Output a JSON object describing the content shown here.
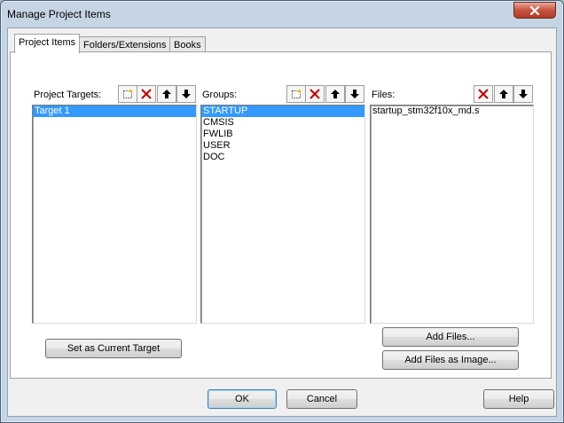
{
  "window": {
    "title": "Manage Project Items"
  },
  "tabs": [
    {
      "label": "Project Items",
      "active": true
    },
    {
      "label": "Folders/Extensions",
      "active": false
    },
    {
      "label": "Books",
      "active": false
    }
  ],
  "targets": {
    "label": "Project Targets:",
    "items": [
      "Target 1"
    ],
    "selected": 0
  },
  "groups": {
    "label": "Groups:",
    "items": [
      "STARTUP",
      "CMSIS",
      "FWLIB",
      "USER",
      "DOC"
    ],
    "selected": 0
  },
  "files": {
    "label": "Files:",
    "items": [
      "startup_stm32f10x_md.s"
    ]
  },
  "buttons": {
    "set_target": "Set as Current Target",
    "add_files": "Add Files...",
    "add_files_image": "Add Files as Image...",
    "ok": "OK",
    "cancel": "Cancel",
    "help": "Help"
  },
  "icons": {
    "new": "new-item-icon",
    "delete": "delete-icon",
    "up": "move-up-icon",
    "down": "move-down-icon",
    "close": "close-icon"
  },
  "colors": {
    "selection": "#3399ff",
    "delete_red": "#c00000",
    "close_red": "#c7523f"
  }
}
